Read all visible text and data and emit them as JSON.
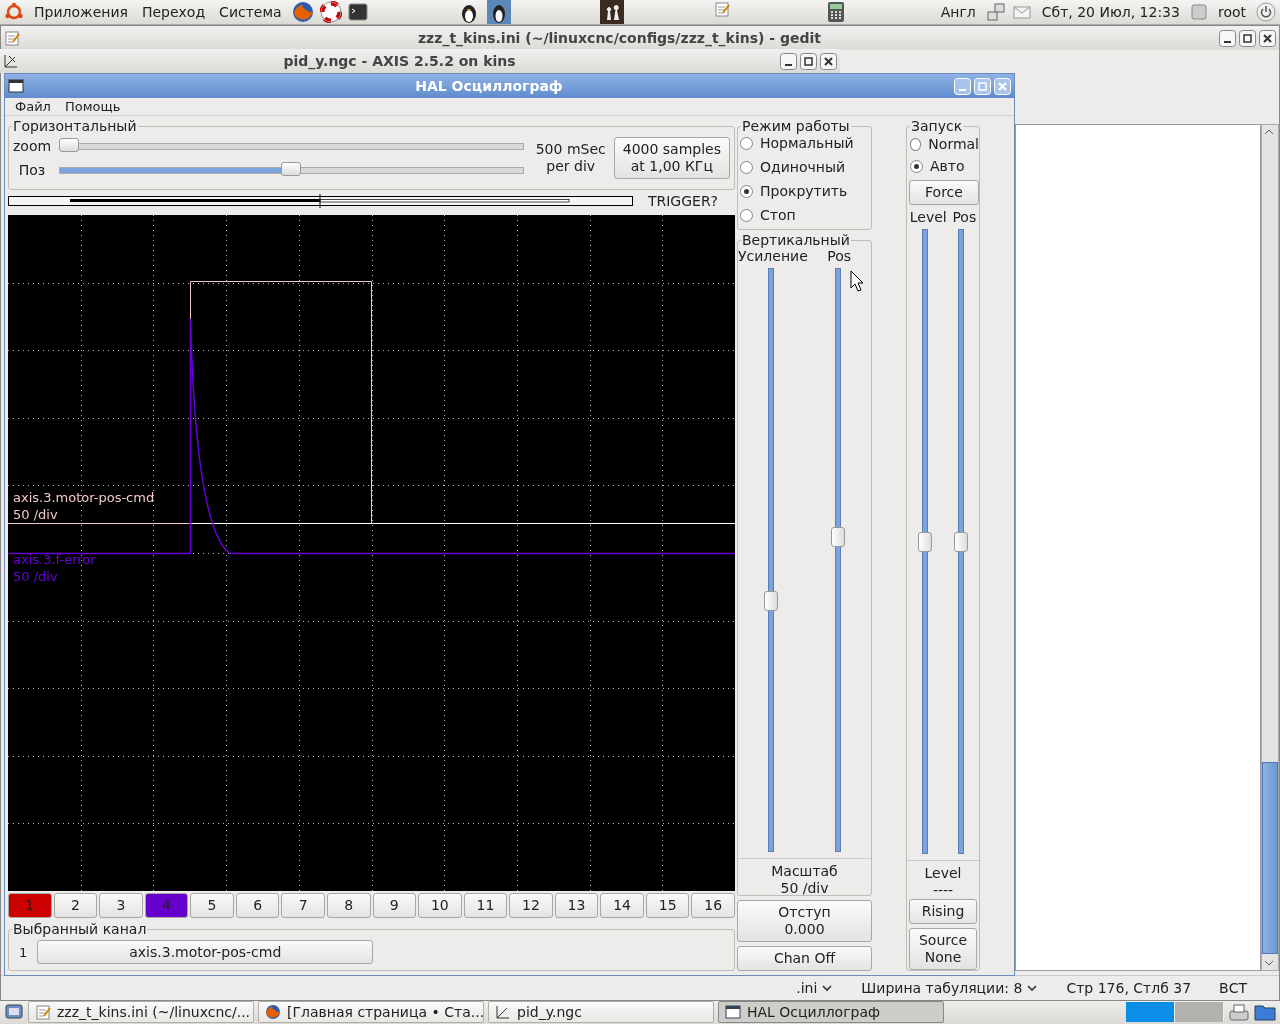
{
  "top_panel": {
    "menus": [
      "Приложения",
      "Переход",
      "Система"
    ],
    "keyboard": "Англ",
    "clock": "Сбт, 20 Июл, 12:33",
    "user": "root"
  },
  "gedit": {
    "title": "zzz_t_kins.ini (~/linuxcnc/configs/zzz_t_kins) - gedit",
    "status_bar": {
      "language": ".ini",
      "tab_width": "Ширина табуляции:  8",
      "position": "Стр 176, Стлб 37",
      "mode": "ВСТ"
    }
  },
  "axis": {
    "title": "pid_y.ngc - AXIS 2.5.2 on kins"
  },
  "scope": {
    "title": "HAL Осциллограф",
    "menu": [
      "Файл",
      "Помощь"
    ],
    "horizontal": {
      "title": "Горизонтальный",
      "zoom": {
        "label": "zoom",
        "level": 0.02
      },
      "pos": {
        "label": "Поз",
        "level": 0.5
      },
      "rate": "500 mSec\nper div",
      "samples_button": "4000 samples\nat 1,00 КГц"
    },
    "trigger_status": "TRIGGER?",
    "traces": [
      {
        "name": "axis.3.motor-pos-cmd",
        "scale": "50 /div",
        "color": "#f2c8c8"
      },
      {
        "name": "axis.3.f-error",
        "scale": "50 /div",
        "color": "#6a00d8"
      }
    ],
    "channels": [
      {
        "label": "1",
        "color": "#cc0000"
      },
      {
        "label": "2"
      },
      {
        "label": "3"
      },
      {
        "label": "4",
        "color": "#6600cc"
      },
      {
        "label": "5"
      },
      {
        "label": "6"
      },
      {
        "label": "7"
      },
      {
        "label": "8"
      },
      {
        "label": "9"
      },
      {
        "label": "10"
      },
      {
        "label": "11"
      },
      {
        "label": "12"
      },
      {
        "label": "13"
      },
      {
        "label": "14"
      },
      {
        "label": "15"
      },
      {
        "label": "16"
      }
    ],
    "selected_channel": {
      "title": "Выбранный канал",
      "number": "1",
      "name": "axis.3.motor-pos-cmd"
    },
    "run_mode": {
      "title": "Режим работы",
      "options": [
        {
          "label": "Нормальный",
          "selected": false
        },
        {
          "label": "Одиночный",
          "selected": false
        },
        {
          "label": "Прокрутить",
          "selected": true
        },
        {
          "label": "Стоп",
          "selected": false
        }
      ]
    },
    "vertical": {
      "title": "Вертикальный",
      "gain": {
        "label": "Усиление",
        "level": 0.43
      },
      "pos": {
        "label": "Pos",
        "level": 0.54
      },
      "scale_label": "Масштаб",
      "scale": "50 /div",
      "offset_button": "Отступ\n0.000",
      "chan_off_button": "Chan Off"
    },
    "trigger": {
      "title": "Запуск",
      "options": [
        {
          "label": "Normal",
          "selected": false
        },
        {
          "label": "Авто",
          "selected": true
        }
      ],
      "force_button": "Force",
      "level_slider": {
        "label": "Level",
        "level": 0.5
      },
      "pos": {
        "label": "Pos",
        "level": 0.5
      },
      "level_heading": "Level",
      "level_value": "----",
      "edge_button": "Rising",
      "source_button": "Source\nNone"
    }
  },
  "taskbar": [
    {
      "label": "zzz_t_kins.ini (~/linuxcnc/...",
      "selected": false
    },
    {
      "label": "[Главная страница • Ста...",
      "selected": false
    },
    {
      "label": "pid_y.ngc",
      "selected": false
    },
    {
      "label": "HAL Осциллограф",
      "selected": true
    }
  ]
}
